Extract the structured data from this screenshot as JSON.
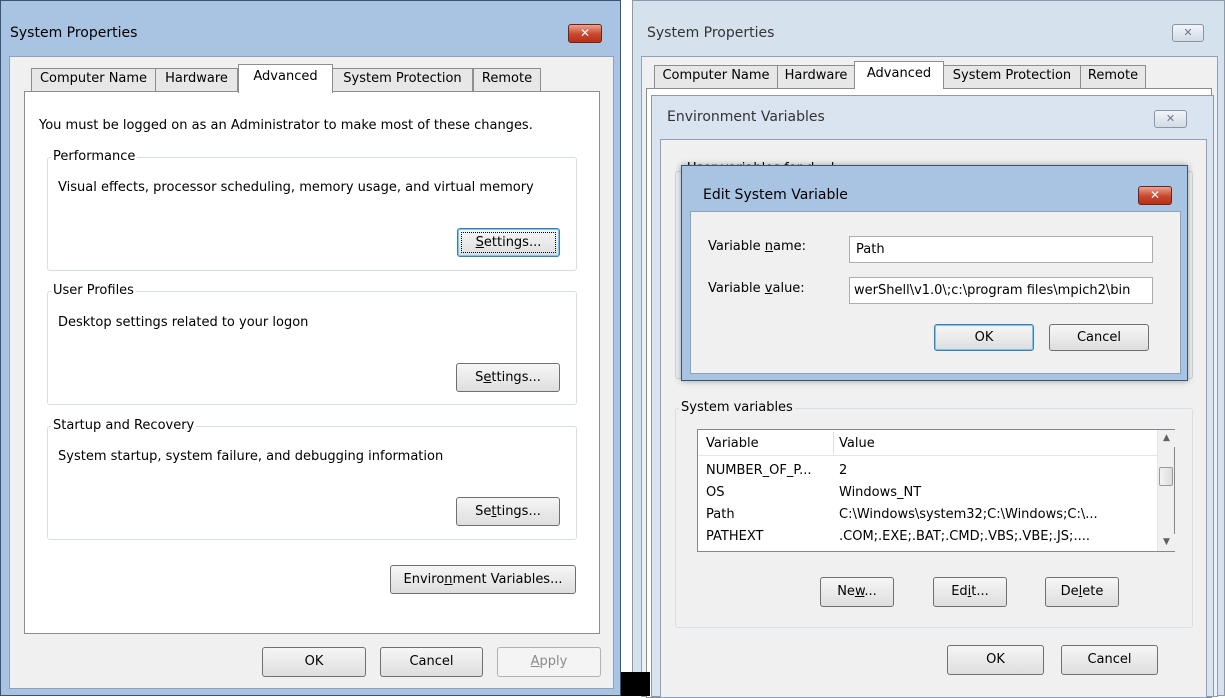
{
  "left": {
    "title": "System Properties",
    "tabs": [
      "Computer Name",
      "Hardware",
      "Advanced",
      "System Protection",
      "Remote"
    ],
    "admin_note": "You must be logged on as an Administrator to make most of these changes.",
    "performance": {
      "label": "Performance",
      "description": "Visual effects, processor scheduling, memory usage, and virtual memory",
      "settings": {
        "pre": "",
        "key": "S",
        "post": "ettings..."
      }
    },
    "user_profiles": {
      "label": "User Profiles",
      "description": "Desktop settings related to your logon",
      "settings": {
        "pre": "S",
        "key": "e",
        "post": "ttings..."
      }
    },
    "startup": {
      "label": "Startup and Recovery",
      "description": "System startup, system failure, and debugging information",
      "settings": {
        "pre": "Se",
        "key": "t",
        "post": "tings..."
      }
    },
    "env_button": {
      "pre": "Enviro",
      "key": "n",
      "post": "ment Variables..."
    },
    "ok": "OK",
    "cancel": "Cancel",
    "apply": {
      "pre": "",
      "key": "A",
      "post": "pply"
    }
  },
  "right": {
    "title": "System Properties",
    "tabs": [
      "Computer Name",
      "Hardware",
      "Advanced",
      "System Protection",
      "Remote"
    ],
    "env_dialog": {
      "title": "Environment Variables",
      "user_vars_label_partial": "User variables for d... k",
      "system_vars": {
        "label": "System variables",
        "headers": [
          "Variable",
          "Value"
        ],
        "rows": [
          {
            "variable": "NUMBER_OF_P...",
            "value": "2"
          },
          {
            "variable": "OS",
            "value": "Windows_NT"
          },
          {
            "variable": "Path",
            "value": "C:\\Windows\\system32;C:\\Windows;C:\\..."
          },
          {
            "variable": "PATHEXT",
            "value": ".COM;.EXE;.BAT;.CMD;.VBS;.VBE;.JS;...."
          }
        ]
      },
      "new": {
        "pre": "Ne",
        "key": "w",
        "post": "..."
      },
      "edit": {
        "pre": "Ed",
        "key": "i",
        "post": "t..."
      },
      "delete": {
        "pre": "De",
        "key": "l",
        "post": "ete"
      },
      "ok": "OK",
      "cancel": "Cancel"
    },
    "edit_dialog": {
      "title": "Edit System Variable",
      "name_label": {
        "pre": "Variable ",
        "key": "n",
        "post": "ame:"
      },
      "value_label": {
        "pre": "Variable ",
        "key": "v",
        "post": "alue:"
      },
      "name_value": "Path",
      "value_value": "werShell\\v1.0\\;c:\\program files\\mpich2\\bin",
      "ok": "OK",
      "cancel": "Cancel"
    }
  },
  "colors": {
    "active_frame": "#a9c4e3",
    "inactive_frame": "#d6e1ee",
    "close_red": "#c9462d",
    "default_button_border": "#3c7fb1"
  }
}
